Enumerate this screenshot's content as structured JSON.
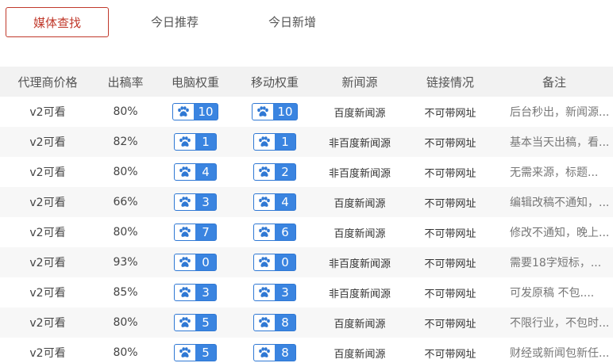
{
  "tabs": [
    {
      "label": "媒体查找",
      "active": true
    },
    {
      "label": "今日推荐",
      "active": false
    },
    {
      "label": "今日新增",
      "active": false
    }
  ],
  "table": {
    "headers": [
      "代理商价格",
      "出稿率",
      "电脑权重",
      "移动权重",
      "新闻源",
      "链接情况",
      "备注"
    ],
    "rows": [
      {
        "price": "v2可看",
        "rate": "80%",
        "pc": "10",
        "mobile": "10",
        "source": "百度新闻源",
        "link": "不可带网址",
        "note": "后台秒出，新闻源..."
      },
      {
        "price": "v2可看",
        "rate": "82%",
        "pc": "1",
        "mobile": "1",
        "source": "非百度新闻源",
        "link": "不可带网址",
        "note": "基本当天出稿，看..."
      },
      {
        "price": "v2可看",
        "rate": "80%",
        "pc": "4",
        "mobile": "2",
        "source": "非百度新闻源",
        "link": "不可带网址",
        "note": "无需来源，标题..."
      },
      {
        "price": "v2可看",
        "rate": "66%",
        "pc": "3",
        "mobile": "4",
        "source": "百度新闻源",
        "link": "不可带网址",
        "note": "编辑改稿不通知，..."
      },
      {
        "price": "v2可看",
        "rate": "80%",
        "pc": "7",
        "mobile": "6",
        "source": "百度新闻源",
        "link": "不可带网址",
        "note": "修改不通知，晚上..."
      },
      {
        "price": "v2可看",
        "rate": "93%",
        "pc": "0",
        "mobile": "0",
        "source": "非百度新闻源",
        "link": "不可带网址",
        "note": "需要18字短标，..."
      },
      {
        "price": "v2可看",
        "rate": "85%",
        "pc": "3",
        "mobile": "3",
        "source": "非百度新闻源",
        "link": "不可带网址",
        "note": "可发原稿 不包...."
      },
      {
        "price": "v2可看",
        "rate": "80%",
        "pc": "5",
        "mobile": "8",
        "source": "百度新闻源",
        "link": "不可带网址",
        "note": "不限行业，不包时..."
      },
      {
        "price": "v2可看",
        "rate": "80%",
        "pc": "5",
        "mobile": "8",
        "source": "百度新闻源",
        "link": "不可带网址",
        "note": "财经或新闻包新任..."
      }
    ]
  },
  "colors": {
    "accent": "#c0392b",
    "badge": "#3a84e0",
    "header_bg": "#f2f2f2"
  },
  "icons": {
    "weight": "paw-icon"
  }
}
